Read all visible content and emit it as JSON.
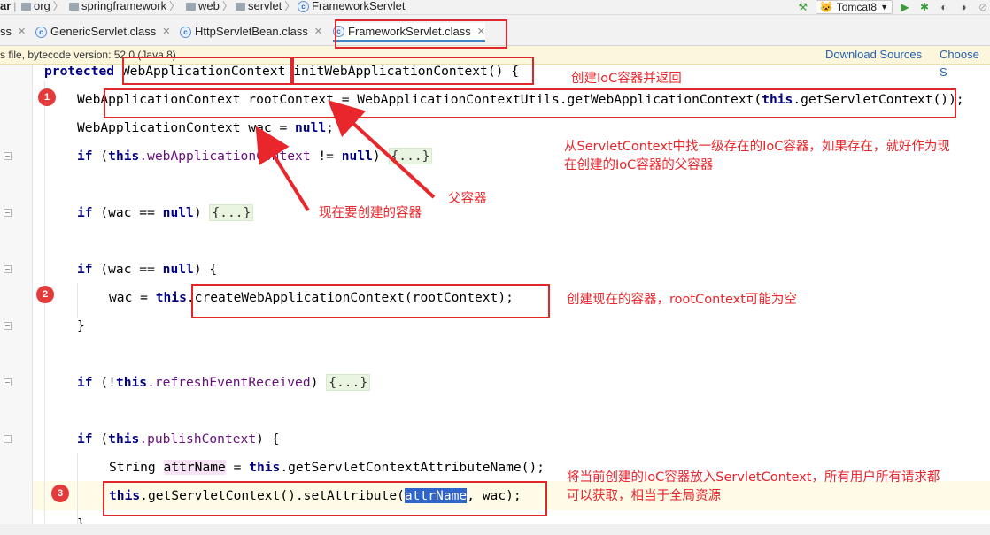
{
  "breadcrumb": {
    "items": [
      "ar",
      "org",
      "springframework",
      "web",
      "servlet"
    ],
    "current": "FrameworkServlet"
  },
  "run_toolbar": {
    "config": "Tomcat8",
    "run_icon": "play-icon",
    "debug_icon": "bug-icon"
  },
  "tabs": [
    {
      "label": "ss",
      "partial": true
    },
    {
      "label": "GenericServlet.class"
    },
    {
      "label": "HttpServletBean.class"
    },
    {
      "label": "FrameworkServlet.class",
      "active": true
    }
  ],
  "banner": {
    "text": "s file, bytecode version: 52.0 (Java 8)",
    "download_sources": "Download Sources",
    "choose_sources": "Choose S"
  },
  "code": {
    "line1": [
      "protected",
      " ",
      "WebApplicationContext",
      " ",
      "initWebApplicationContext",
      "() {"
    ],
    "line2": "WebApplicationContext rootContext = WebApplicationContextUtils.getWebApplicationContext(",
    "line2_this": "this",
    "line2_end": ".getServletContext());",
    "line3": "WebApplicationContext wac = ",
    "line3_null": "null",
    "line3_end": ";",
    "line4_if": "if",
    "line4_a": " (",
    "line4_this": "this",
    "line4_field": ".webApplicationContext",
    "line4_b": " != ",
    "line4_null": "null",
    "line4_c": ") ",
    "fold": "{...}",
    "line5_if": "if",
    "line5_a": " (wac == ",
    "line5_null": "null",
    "line5_b": ") ",
    "line6_if": "if",
    "line6_a": " (wac == ",
    "line6_null": "null",
    "line6_b": ") {",
    "line7_a": "wac = ",
    "line7_this": "this",
    "line7_b": ".createWebApplicationContext(rootContext);",
    "close_brace": "}",
    "line8_if": "if",
    "line8_a": " (!",
    "line8_this": "this",
    "line8_field": ".refreshEventReceived",
    "line8_b": ") ",
    "line9_if": "if",
    "line9_a": " (",
    "line9_this": "this",
    "line9_field": ".publishContext",
    "line9_b": ") {",
    "line10_type": "String ",
    "line10_var": "attrName",
    "line10_a": " = ",
    "line10_this": "this",
    "line10_b": ".getServletContextAttributeName();",
    "line11_this": "this",
    "line11_a": ".getServletContext().setAttribute(",
    "line11_sel": "attrName",
    "line11_b": ", wac);"
  },
  "annotations": {
    "n1": "创建IoC容器并返回",
    "n2_line1": "从ServletContext中找一级存在的IoC容器，如果存在，就好作为现",
    "n2_line2": "在创建的IoC容器的父容器",
    "n3": "父容器",
    "n4": "现在要创建的容器",
    "n5": "创建现在的容器，rootContext可能为空",
    "n6_line1": "将当前创建的IoC容器放入ServletContext，所有用户所有请求都",
    "n6_line2": "可以获取，相当于全局资源",
    "badge1": "1",
    "badge2": "2",
    "badge3": "3"
  },
  "colors": {
    "annotation_red": "#e8262b",
    "keyword": "#000080",
    "field": "#660e7a",
    "selection": "#2f65ca"
  }
}
